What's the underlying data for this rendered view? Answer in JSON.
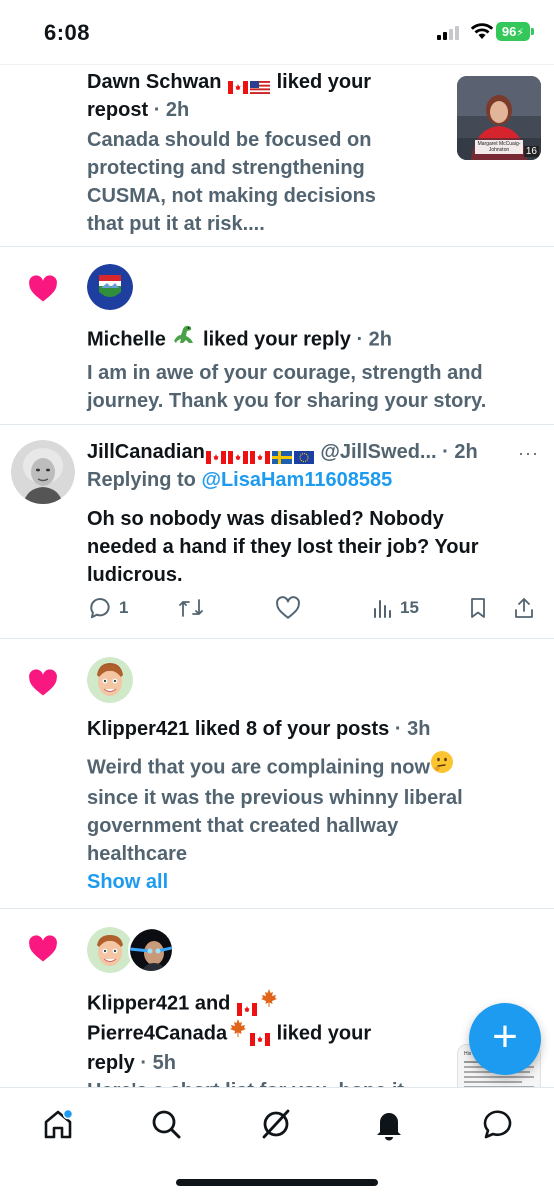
{
  "status": {
    "time": "6:08",
    "battery": "96"
  },
  "notifications": [
    {
      "head_name": "Dawn Schwan",
      "head_action": "liked your",
      "head_line2": "repost",
      "time": "· 2h",
      "body_lines": [
        "Canada should be focused on",
        "protecting and strengthening",
        "CUSMA, not making decisions",
        "that put it at risk...."
      ],
      "thumb_caption": "Margaret McCuaig-Johnston",
      "thumb_badge": "16"
    },
    {
      "head_name": "Michelle",
      "head_action": "liked your reply",
      "time": "· 2h",
      "body_lines": [
        "I am in awe of your courage, strength and",
        "journey. Thank you for sharing your story."
      ]
    },
    {
      "head_name": "Klipper421 liked 8 of your posts",
      "time": "· 3h",
      "body_lines": [
        "Weird that you are complaining now",
        "since it was the previous whinny liberal",
        "government that created hallway",
        "healthcare"
      ],
      "show_all": "Show all"
    },
    {
      "head_line1_name": "Klipper421 and",
      "head_line2_name": "Pierre4Canada",
      "head_line2_action": "liked your",
      "head_line3": "reply",
      "time": "· 5h",
      "body_partial": "Here's a short list for you, hope it",
      "thumb_title": "His record includes:"
    }
  ],
  "tweet": {
    "name": "JillCanadian",
    "handle": "@JillSwed...",
    "time": "· 2h",
    "more": "···",
    "replying_label": "Replying to",
    "replying_handle": "@LisaHam11608585",
    "text_lines": [
      "Oh so nobody was disabled? Nobody",
      "needed a hand if they lost their job? Your",
      "ludicrous."
    ],
    "replies": "1",
    "views": "15"
  },
  "fab_label": "+",
  "colors": {
    "accent": "#1d9bf0",
    "like": "#f91880",
    "secondary_text": "#536471"
  }
}
